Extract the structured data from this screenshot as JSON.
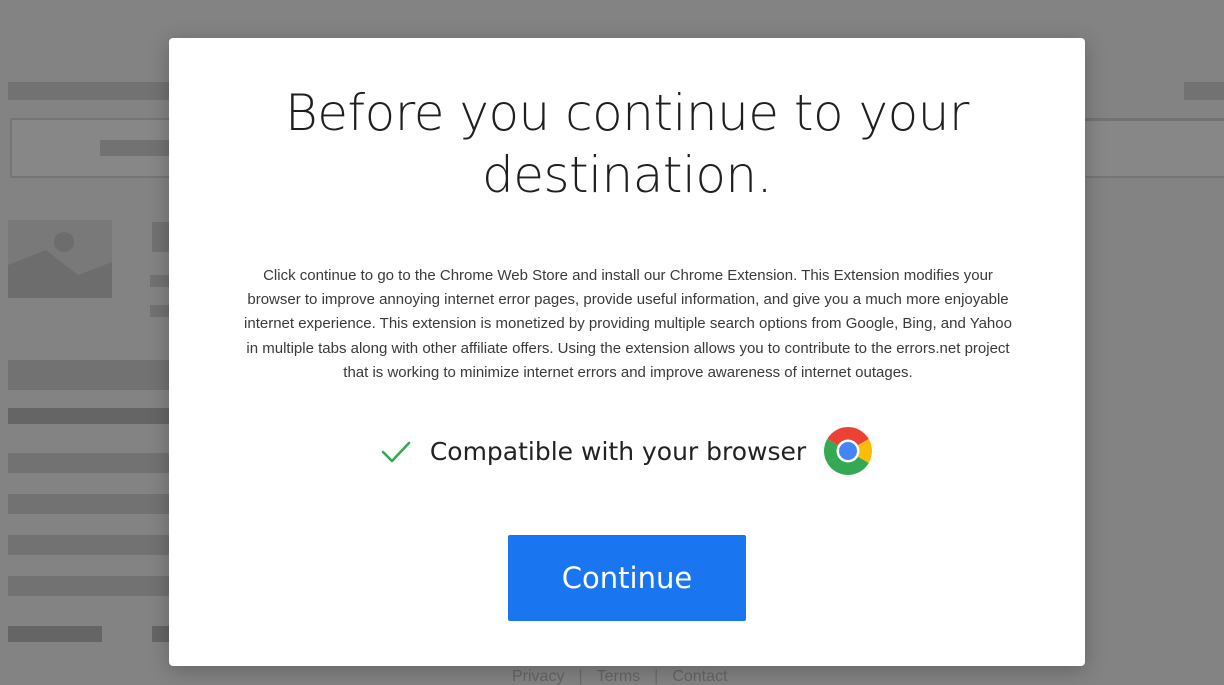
{
  "background": {
    "footer_links": [
      "Privacy",
      "Terms",
      "Contact"
    ],
    "footer_separator": "|"
  },
  "modal": {
    "title": "Before you continue to your destination.",
    "body": "Click continue to go to the Chrome Web Store and install our Chrome Extension. This Extension modifies your browser to improve annoying internet error pages, provide useful information, and give you a much more enjoyable internet experience. This extension is monetized by providing multiple search options from Google, Bing, and Yahoo in multiple tabs along with other affiliate offers. Using the extension allows you to contribute to the errors.net project that is working to minimize internet errors and improve awareness of internet outages.",
    "compat_text": "Compatible with your browser",
    "compat_icons": [
      "check-icon",
      "chrome-icon"
    ],
    "button_label": "Continue"
  },
  "colors": {
    "button": "#1a76f0",
    "check": "#34a853",
    "overlay": "rgba(0,0,0,0.45)"
  }
}
